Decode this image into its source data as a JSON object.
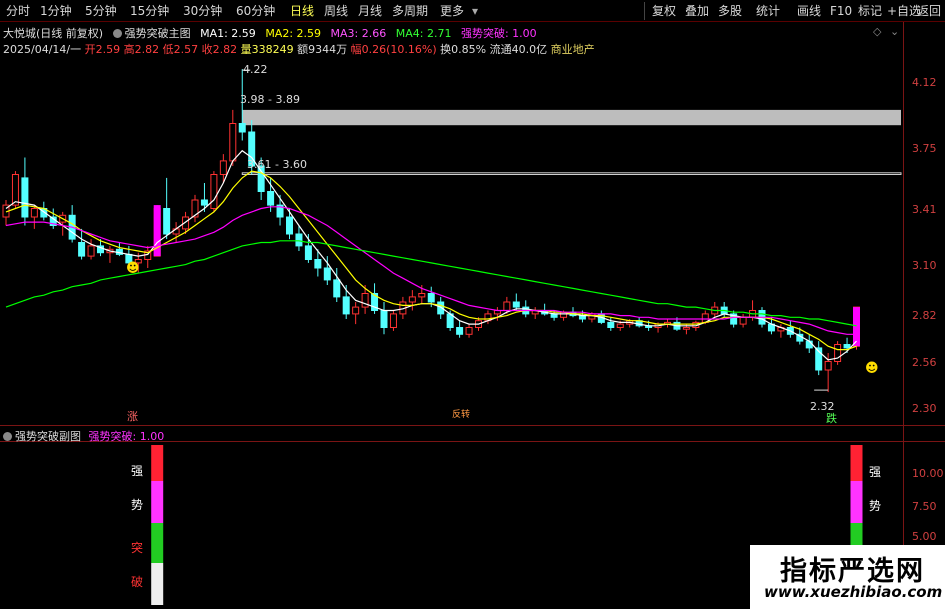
{
  "toolbar": {
    "periods": [
      "分时",
      "1分钟",
      "5分钟",
      "15分钟",
      "30分钟",
      "60分钟",
      "日线",
      "周线",
      "月线",
      "多周期",
      "更多"
    ],
    "active_period": "日线",
    "right_buttons": [
      "复权",
      "叠加",
      "多股",
      "统计",
      "画线",
      "F10",
      "标记",
      "+自选",
      "返回"
    ]
  },
  "stock": {
    "name_mode": "大悦城(日线 前复权)",
    "indicator": "强势突破主图",
    "ma1": "MA1: 2.59",
    "ma2": "MA2: 2.59",
    "ma3": "MA3: 2.66",
    "ma4": "MA4: 2.71",
    "signal": "强势突破: 1.00",
    "date": "2025/04/14/一",
    "open": "开2.59",
    "high": "高2.82",
    "low": "低2.57",
    "close": "收2.82",
    "volume": "量338249",
    "amount": "额9344万",
    "change": "幅0.26(10.16%)",
    "turnover": "换0.85%",
    "float": "流通40.0亿",
    "sector": "商业地产"
  },
  "sub": {
    "indicator": "强势突破副图",
    "signal": "强势突破: 1.00",
    "bar_chars": [
      "强",
      "势",
      "突",
      "破"
    ]
  },
  "markers": {
    "zhang": "涨",
    "fan": "反转",
    "die": "跌",
    "high_label": "4.22",
    "low_label": "2.32",
    "zone1": "3.98 - 3.89",
    "zone2": "3.61 - 3.60"
  },
  "colors": {
    "up": "#ff3232",
    "down": "#54ffff",
    "ma1": "#ffffff",
    "ma2": "#ffff00",
    "ma3": "#ff00ff",
    "ma4": "#00ff00",
    "signal": "#ff00ff"
  },
  "chart_data": [
    {
      "type": "candlestick",
      "title": "强势突破主图",
      "y_ticks": [
        "4.12",
        "3.75",
        "3.41",
        "3.10",
        "2.82",
        "2.56",
        "2.30"
      ],
      "ylim": [
        2.25,
        4.25
      ],
      "candles": [
        [
          3.35,
          3.45,
          3.3,
          3.42
        ],
        [
          3.42,
          3.62,
          3.4,
          3.6
        ],
        [
          3.58,
          3.7,
          3.3,
          3.35
        ],
        [
          3.35,
          3.42,
          3.28,
          3.4
        ],
        [
          3.4,
          3.44,
          3.33,
          3.35
        ],
        [
          3.35,
          3.4,
          3.28,
          3.3
        ],
        [
          3.32,
          3.38,
          3.24,
          3.36
        ],
        [
          3.36,
          3.42,
          3.2,
          3.22
        ],
        [
          3.2,
          3.28,
          3.1,
          3.12
        ],
        [
          3.12,
          3.22,
          3.1,
          3.18
        ],
        [
          3.18,
          3.22,
          3.12,
          3.14
        ],
        [
          3.14,
          3.18,
          3.08,
          3.16
        ],
        [
          3.16,
          3.2,
          3.12,
          3.13
        ],
        [
          3.13,
          3.18,
          3.06,
          3.08
        ],
        [
          3.08,
          3.14,
          3.02,
          3.1
        ],
        [
          3.1,
          3.18,
          3.05,
          3.15
        ],
        [
          3.12,
          3.42,
          3.12,
          3.4
        ],
        [
          3.4,
          3.58,
          3.22,
          3.25
        ],
        [
          3.25,
          3.32,
          3.2,
          3.28
        ],
        [
          3.28,
          3.38,
          3.25,
          3.35
        ],
        [
          3.35,
          3.48,
          3.32,
          3.45
        ],
        [
          3.45,
          3.55,
          3.38,
          3.42
        ],
        [
          3.4,
          3.62,
          3.38,
          3.6
        ],
        [
          3.6,
          3.72,
          3.55,
          3.68
        ],
        [
          3.68,
          3.98,
          3.65,
          3.9
        ],
        [
          3.9,
          4.22,
          3.8,
          3.85
        ],
        [
          3.85,
          3.92,
          3.6,
          3.65
        ],
        [
          3.65,
          3.7,
          3.45,
          3.5
        ],
        [
          3.5,
          3.58,
          3.38,
          3.42
        ],
        [
          3.42,
          3.48,
          3.3,
          3.35
        ],
        [
          3.35,
          3.4,
          3.22,
          3.25
        ],
        [
          3.25,
          3.3,
          3.15,
          3.18
        ],
        [
          3.18,
          3.25,
          3.08,
          3.1
        ],
        [
          3.1,
          3.16,
          3.0,
          3.05
        ],
        [
          3.05,
          3.12,
          2.95,
          2.98
        ],
        [
          2.98,
          3.05,
          2.85,
          2.88
        ],
        [
          2.88,
          2.95,
          2.75,
          2.78
        ],
        [
          2.78,
          2.85,
          2.72,
          2.82
        ],
        [
          2.82,
          2.95,
          2.78,
          2.9
        ],
        [
          2.9,
          2.96,
          2.78,
          2.8
        ],
        [
          2.8,
          2.85,
          2.66,
          2.7
        ],
        [
          2.7,
          2.8,
          2.68,
          2.78
        ],
        [
          2.78,
          2.88,
          2.75,
          2.85
        ],
        [
          2.85,
          2.92,
          2.8,
          2.88
        ],
        [
          2.88,
          2.95,
          2.84,
          2.9
        ],
        [
          2.9,
          2.94,
          2.82,
          2.85
        ],
        [
          2.85,
          2.88,
          2.75,
          2.78
        ],
        [
          2.78,
          2.8,
          2.68,
          2.7
        ],
        [
          2.7,
          2.74,
          2.64,
          2.66
        ],
        [
          2.66,
          2.72,
          2.64,
          2.7
        ],
        [
          2.7,
          2.76,
          2.68,
          2.74
        ],
        [
          2.74,
          2.8,
          2.72,
          2.78
        ],
        [
          2.78,
          2.82,
          2.74,
          2.8
        ],
        [
          2.8,
          2.88,
          2.78,
          2.85
        ],
        [
          2.85,
          2.9,
          2.8,
          2.82
        ],
        [
          2.82,
          2.86,
          2.76,
          2.78
        ],
        [
          2.78,
          2.82,
          2.75,
          2.8
        ],
        [
          2.8,
          2.84,
          2.77,
          2.78
        ],
        [
          2.78,
          2.8,
          2.74,
          2.76
        ],
        [
          2.76,
          2.8,
          2.74,
          2.79
        ],
        [
          2.79,
          2.82,
          2.76,
          2.77
        ],
        [
          2.77,
          2.8,
          2.73,
          2.75
        ],
        [
          2.75,
          2.79,
          2.73,
          2.78
        ],
        [
          2.78,
          2.8,
          2.72,
          2.73
        ],
        [
          2.73,
          2.76,
          2.68,
          2.7
        ],
        [
          2.7,
          2.74,
          2.68,
          2.72
        ],
        [
          2.72,
          2.75,
          2.7,
          2.74
        ],
        [
          2.74,
          2.76,
          2.7,
          2.71
        ],
        [
          2.71,
          2.74,
          2.68,
          2.7
        ],
        [
          2.7,
          2.73,
          2.67,
          2.72
        ],
        [
          2.72,
          2.75,
          2.7,
          2.73
        ],
        [
          2.73,
          2.76,
          2.68,
          2.69
        ],
        [
          2.69,
          2.72,
          2.66,
          2.7
        ],
        [
          2.7,
          2.74,
          2.68,
          2.73
        ],
        [
          2.73,
          2.8,
          2.72,
          2.78
        ],
        [
          2.78,
          2.85,
          2.76,
          2.82
        ],
        [
          2.82,
          2.85,
          2.76,
          2.78
        ],
        [
          2.78,
          2.8,
          2.7,
          2.72
        ],
        [
          2.72,
          2.78,
          2.7,
          2.76
        ],
        [
          2.76,
          2.86,
          2.74,
          2.8
        ],
        [
          2.8,
          2.82,
          2.7,
          2.72
        ],
        [
          2.72,
          2.76,
          2.66,
          2.68
        ],
        [
          2.68,
          2.72,
          2.64,
          2.7
        ],
        [
          2.7,
          2.74,
          2.64,
          2.66
        ],
        [
          2.66,
          2.7,
          2.6,
          2.62
        ],
        [
          2.62,
          2.66,
          2.55,
          2.58
        ],
        [
          2.58,
          2.62,
          2.42,
          2.45
        ],
        [
          2.45,
          2.55,
          2.32,
          2.5
        ],
        [
          2.5,
          2.62,
          2.48,
          2.6
        ],
        [
          2.6,
          2.64,
          2.55,
          2.58
        ],
        [
          2.59,
          2.82,
          2.57,
          2.82
        ]
      ],
      "series": [
        {
          "name": "MA1",
          "values": [
            3.4,
            3.44,
            3.43,
            3.42,
            3.38,
            3.34,
            3.3,
            3.26,
            3.22,
            3.19,
            3.17,
            3.15,
            3.14,
            3.13,
            3.12,
            3.13,
            3.2,
            3.24,
            3.28,
            3.32,
            3.36,
            3.4,
            3.45,
            3.55,
            3.68,
            3.74,
            3.7,
            3.62,
            3.54,
            3.46,
            3.38,
            3.3,
            3.22,
            3.15,
            3.08,
            3.0,
            2.92,
            2.86,
            2.84,
            2.82,
            2.8,
            2.8,
            2.81,
            2.83,
            2.84,
            2.84,
            2.82,
            2.78,
            2.74,
            2.72,
            2.72,
            2.74,
            2.76,
            2.79,
            2.81,
            2.81,
            2.8,
            2.79,
            2.78,
            2.78,
            2.78,
            2.77,
            2.77,
            2.76,
            2.74,
            2.73,
            2.73,
            2.72,
            2.71,
            2.71,
            2.72,
            2.71,
            2.71,
            2.71,
            2.73,
            2.76,
            2.78,
            2.77,
            2.76,
            2.76,
            2.75,
            2.72,
            2.7,
            2.68,
            2.65,
            2.62,
            2.56,
            2.51,
            2.52,
            2.56,
            2.62
          ]
        },
        {
          "name": "MA2",
          "values": [
            3.38,
            3.4,
            3.42,
            3.41,
            3.4,
            3.37,
            3.34,
            3.31,
            3.27,
            3.24,
            3.21,
            3.19,
            3.17,
            3.16,
            3.15,
            3.14,
            3.17,
            3.2,
            3.23,
            3.26,
            3.3,
            3.34,
            3.38,
            3.44,
            3.52,
            3.58,
            3.62,
            3.61,
            3.58,
            3.53,
            3.47,
            3.4,
            3.33,
            3.26,
            3.19,
            3.12,
            3.05,
            2.98,
            2.93,
            2.89,
            2.86,
            2.84,
            2.83,
            2.83,
            2.84,
            2.84,
            2.83,
            2.81,
            2.78,
            2.76,
            2.75,
            2.75,
            2.76,
            2.77,
            2.79,
            2.8,
            2.8,
            2.8,
            2.79,
            2.79,
            2.78,
            2.78,
            2.77,
            2.77,
            2.76,
            2.75,
            2.74,
            2.74,
            2.73,
            2.72,
            2.72,
            2.72,
            2.72,
            2.72,
            2.73,
            2.74,
            2.76,
            2.76,
            2.76,
            2.76,
            2.76,
            2.75,
            2.73,
            2.71,
            2.69,
            2.66,
            2.63,
            2.59,
            2.57,
            2.57,
            2.59
          ]
        },
        {
          "name": "MA3",
          "values": [
            3.3,
            3.31,
            3.32,
            3.32,
            3.32,
            3.31,
            3.3,
            3.29,
            3.27,
            3.25,
            3.23,
            3.21,
            3.2,
            3.19,
            3.18,
            3.17,
            3.18,
            3.19,
            3.2,
            3.21,
            3.22,
            3.24,
            3.26,
            3.29,
            3.33,
            3.36,
            3.38,
            3.4,
            3.41,
            3.41,
            3.4,
            3.38,
            3.36,
            3.33,
            3.3,
            3.26,
            3.22,
            3.18,
            3.14,
            3.1,
            3.06,
            3.02,
            2.99,
            2.96,
            2.93,
            2.91,
            2.89,
            2.87,
            2.85,
            2.83,
            2.82,
            2.81,
            2.8,
            2.8,
            2.8,
            2.8,
            2.8,
            2.8,
            2.8,
            2.79,
            2.79,
            2.79,
            2.78,
            2.78,
            2.78,
            2.77,
            2.77,
            2.76,
            2.76,
            2.75,
            2.75,
            2.75,
            2.75,
            2.75,
            2.75,
            2.75,
            2.75,
            2.76,
            2.76,
            2.76,
            2.76,
            2.76,
            2.75,
            2.74,
            2.73,
            2.72,
            2.7,
            2.68,
            2.67,
            2.66,
            2.66
          ]
        },
        {
          "name": "MA4",
          "values": [
            2.82,
            2.84,
            2.86,
            2.88,
            2.89,
            2.91,
            2.92,
            2.94,
            2.95,
            2.96,
            2.98,
            2.99,
            3.0,
            3.01,
            3.02,
            3.03,
            3.04,
            3.05,
            3.06,
            3.07,
            3.09,
            3.1,
            3.12,
            3.14,
            3.16,
            3.18,
            3.19,
            3.2,
            3.2,
            3.21,
            3.21,
            3.21,
            3.2,
            3.2,
            3.19,
            3.18,
            3.17,
            3.16,
            3.15,
            3.14,
            3.13,
            3.12,
            3.11,
            3.1,
            3.09,
            3.08,
            3.07,
            3.06,
            3.05,
            3.04,
            3.03,
            3.02,
            3.01,
            3.0,
            2.99,
            2.98,
            2.97,
            2.96,
            2.95,
            2.94,
            2.93,
            2.92,
            2.91,
            2.9,
            2.89,
            2.88,
            2.87,
            2.86,
            2.85,
            2.84,
            2.84,
            2.83,
            2.82,
            2.82,
            2.81,
            2.8,
            2.8,
            2.79,
            2.79,
            2.78,
            2.78,
            2.77,
            2.77,
            2.76,
            2.76,
            2.75,
            2.75,
            2.74,
            2.73,
            2.72,
            2.71
          ]
        }
      ],
      "signals": [
        {
          "index": 16,
          "from": 3.12,
          "to": 3.42
        },
        {
          "index": 90,
          "from": 2.59,
          "to": 2.82
        }
      ],
      "zones": [
        {
          "y_top": 3.98,
          "y_bottom": 3.89,
          "label": "3.98 - 3.89"
        },
        {
          "y_top": 3.61,
          "y_bottom": 3.6,
          "label": "3.61 - 3.60"
        }
      ]
    },
    {
      "type": "bar",
      "title": "强势突破副图",
      "y_ticks": [
        "10.00",
        "7.50",
        "5.00"
      ],
      "ylim": [
        0,
        12
      ],
      "signal_indices": [
        16,
        90
      ]
    }
  ]
}
